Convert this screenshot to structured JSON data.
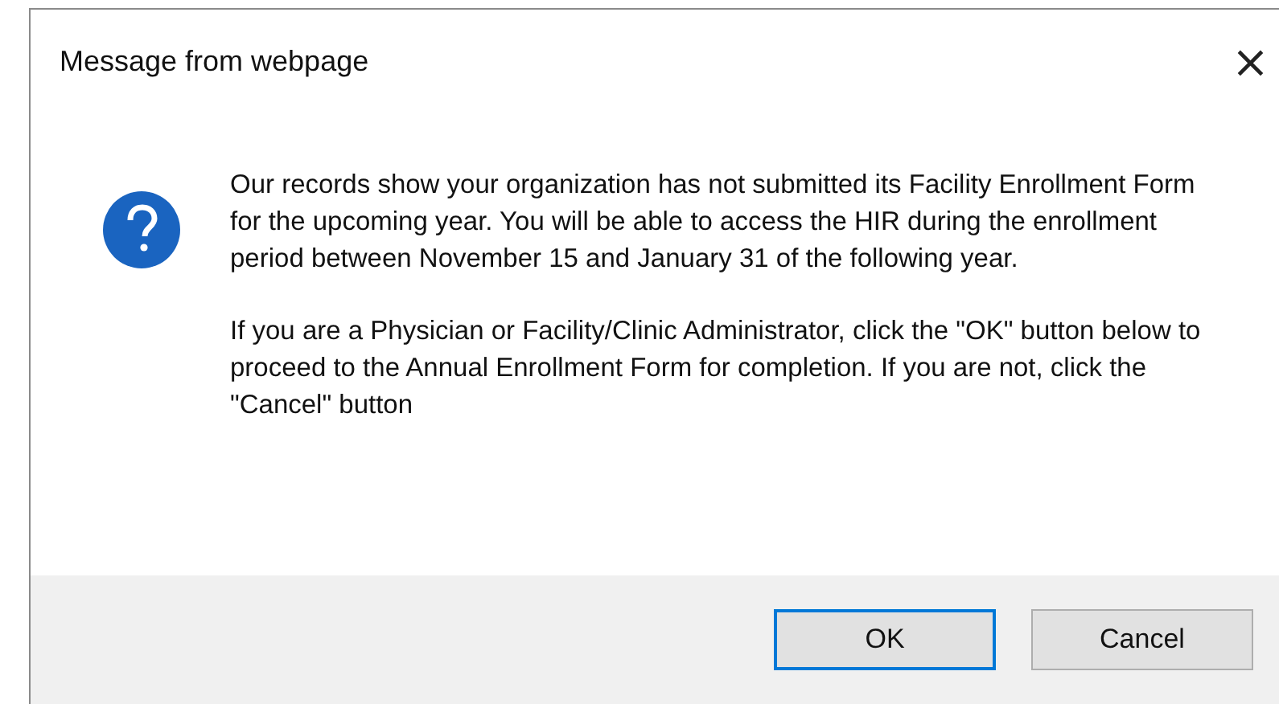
{
  "window": {
    "title": "Message from webpage",
    "close": "×"
  },
  "message": {
    "paragraphs": [
      "Our records show your organization has not submitted its Facility Enrollment Form for the upcoming year. You will be able to access the HIR during the enrollment period between November 15 and January 31 of the following year.",
      "If you are a Physician or Facility/Clinic Administrator, click the \"OK\" button below to proceed to the Annual Enrollment Form for completion. If you are not, click the \"Cancel\" button"
    ]
  },
  "buttons": [
    {
      "label": "OK",
      "selected": true
    },
    {
      "label": "Cancel",
      "selected": false
    }
  ]
}
